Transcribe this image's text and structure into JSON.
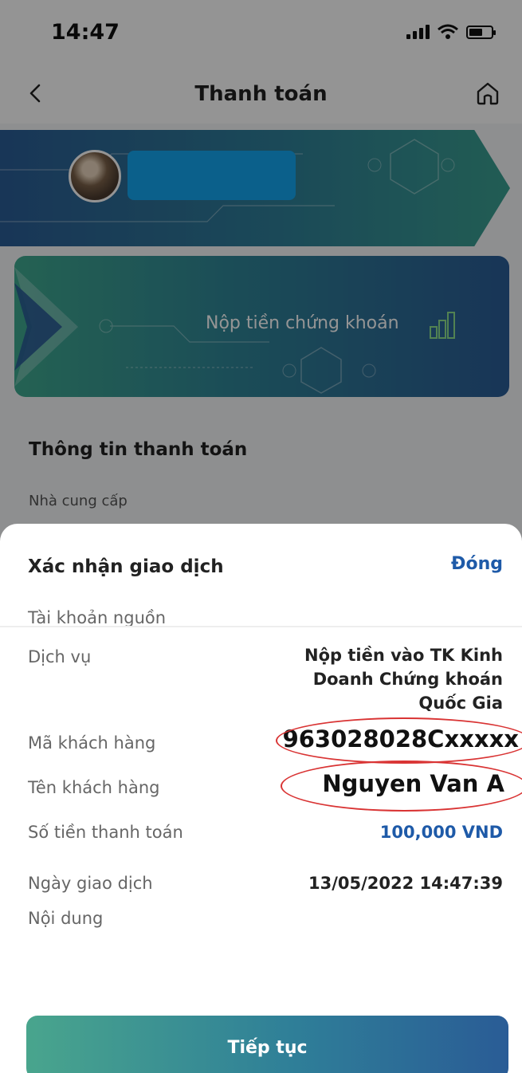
{
  "status_bar": {
    "time": "14:47"
  },
  "header": {
    "title": "Thanh toán"
  },
  "service_card": {
    "label": "Nộp tiền chứng khoán"
  },
  "section": {
    "title": "Thông tin thanh toán",
    "provider_label": "Nhà cung cấp"
  },
  "sheet": {
    "title": "Xác nhận giao dịch",
    "close_label": "Đóng",
    "rows": [
      {
        "label": "Tài khoản nguồn",
        "value": ""
      },
      {
        "label": "Dịch vụ",
        "value": "Nộp tiền vào TK Kinh Doanh Chứng khoán Quốc Gia"
      },
      {
        "label": "Mã khách hàng",
        "value": "963028028Cxxxxx"
      },
      {
        "label": "Tên khách hàng",
        "value": "Nguyen Van A"
      },
      {
        "label": "Số tiền thanh toán",
        "value": "100,000 VND"
      },
      {
        "label": "Ngày giao dịch",
        "value": "13/05/2022 14:47:39"
      },
      {
        "label": "Nội dung",
        "value": ""
      }
    ],
    "continue_label": "Tiếp tục"
  },
  "colors": {
    "accent": "#1e5aa8",
    "highlight_ring": "#d93434",
    "avatar_blur": "#14a5f0"
  },
  "icons": {
    "back": "chevron-left-icon",
    "home": "home-icon",
    "chart": "bar-chart-icon"
  }
}
